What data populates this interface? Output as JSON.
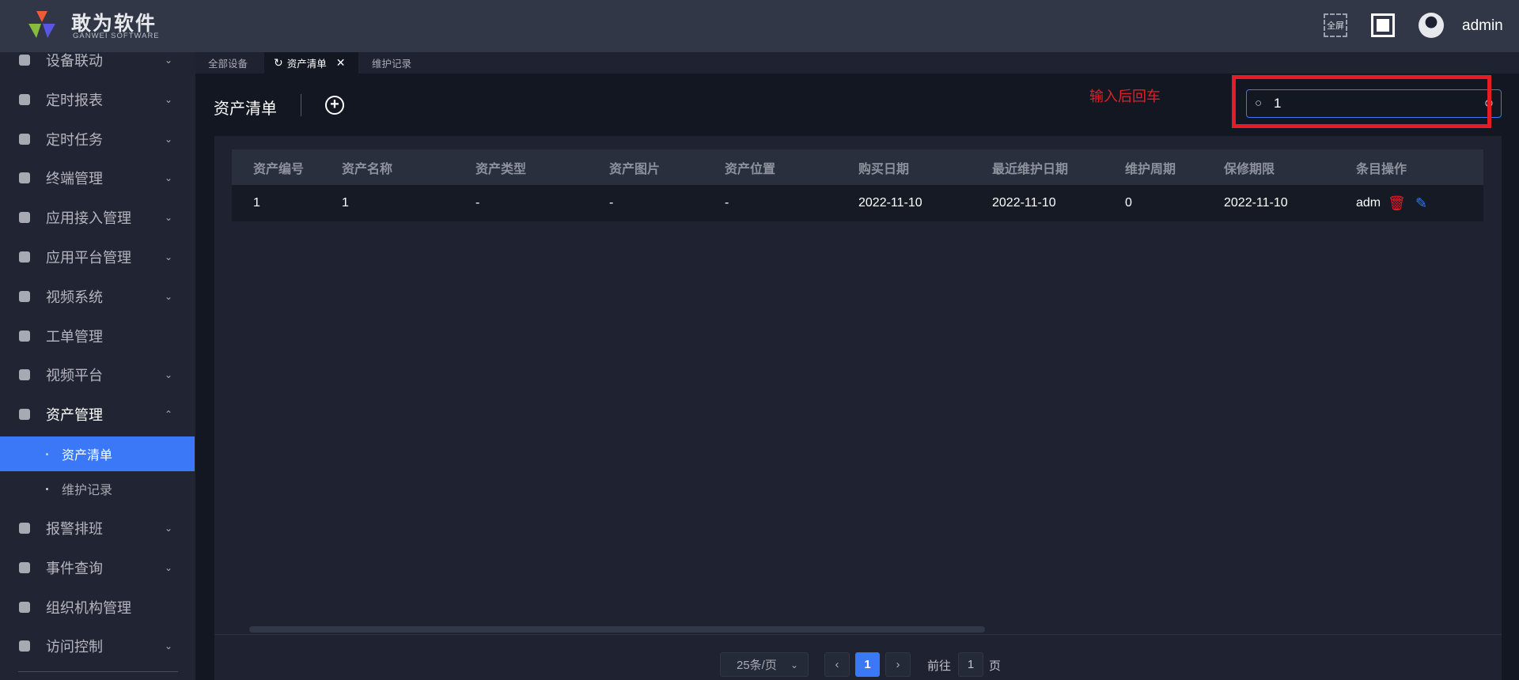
{
  "header": {
    "brand": "敢为软件",
    "brand_sub": "GANWEI SOFTWARE",
    "fullscreen_label": "全屏",
    "user": "admin"
  },
  "sidebar": {
    "items": [
      {
        "label": "设备联动",
        "chevron": "⌄"
      },
      {
        "label": "定时报表",
        "chevron": "⌄"
      },
      {
        "label": "定时任务",
        "chevron": "⌄"
      },
      {
        "label": "终端管理",
        "chevron": "⌄"
      },
      {
        "label": "应用接入管理",
        "chevron": "⌄"
      },
      {
        "label": "应用平台管理",
        "chevron": "⌄"
      },
      {
        "label": "视频系统",
        "chevron": "⌄"
      },
      {
        "label": "工单管理",
        "chevron": ""
      },
      {
        "label": "视频平台",
        "chevron": "⌄"
      },
      {
        "label": "资产管理",
        "chevron": "⌃"
      }
    ],
    "sub_items": [
      {
        "label": "资产清单",
        "active": true
      },
      {
        "label": "维护记录",
        "active": false
      }
    ],
    "items_after": [
      {
        "label": "报警排班",
        "chevron": "⌄"
      },
      {
        "label": "事件查询",
        "chevron": "⌄"
      },
      {
        "label": "组织机构管理",
        "chevron": ""
      },
      {
        "label": "访问控制",
        "chevron": "⌄"
      }
    ]
  },
  "tabs": [
    {
      "label": "全部设备"
    },
    {
      "label": "资产清单",
      "active": true
    },
    {
      "label": "维护记录"
    }
  ],
  "page": {
    "title": "资产清单",
    "hint": "输入后回车",
    "search_value": "1"
  },
  "table": {
    "columns": [
      "资产编号",
      "资产名称",
      "资产类型",
      "资产图片",
      "资产位置",
      "购买日期",
      "最近维护日期",
      "维护周期",
      "保修期限",
      "条目",
      "操作"
    ],
    "rows": [
      [
        "1",
        "1",
        "-",
        "-",
        "-",
        "2022-11-10",
        "2022-11-10",
        "0",
        "2022-11-10",
        "admin"
      ]
    ]
  },
  "pagination": {
    "page_size": "25条/页",
    "current_page": "1",
    "goto_label": "前往",
    "goto_value": "1",
    "page_suffix": "页"
  },
  "colors": {
    "accent": "#3a78f8",
    "danger": "#e51c23"
  }
}
